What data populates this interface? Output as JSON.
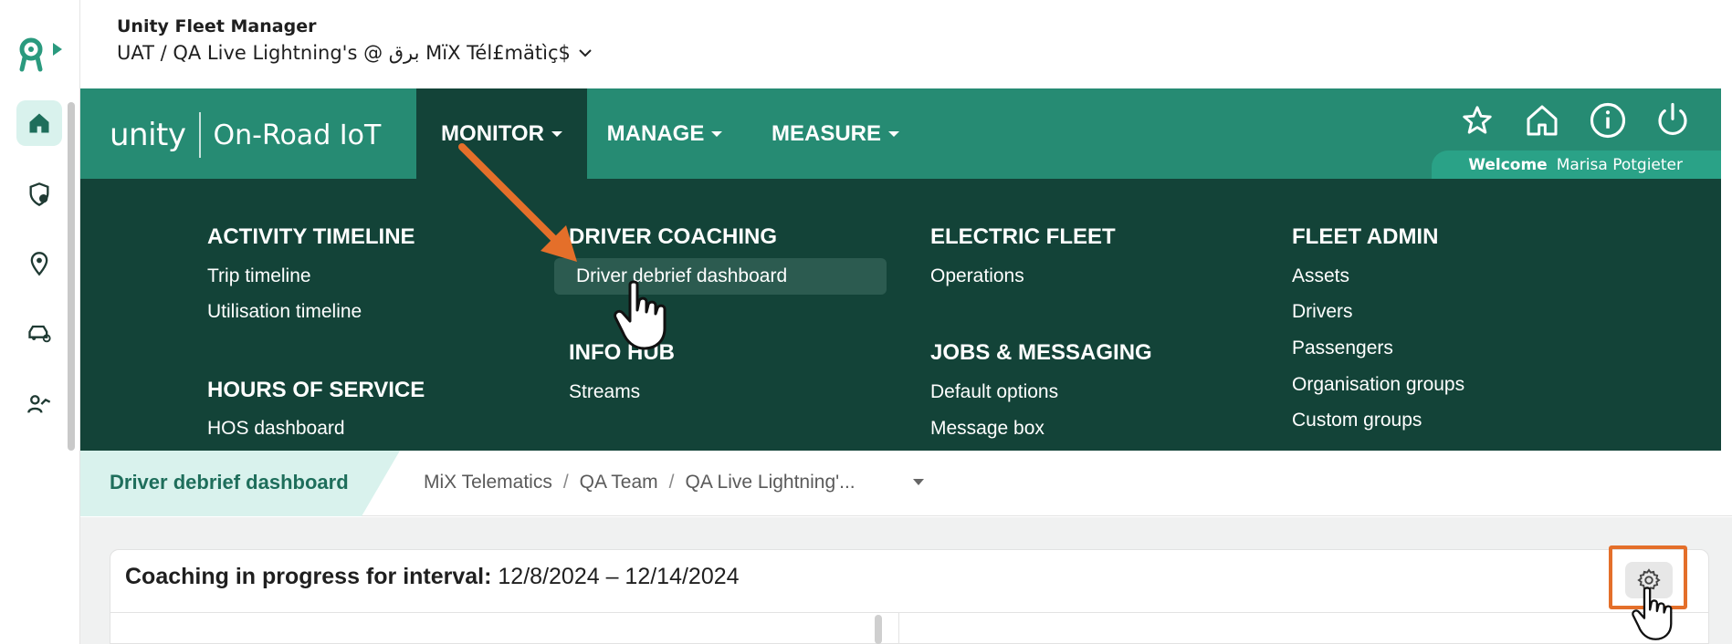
{
  "app": {
    "title": "Unity Fleet Manager",
    "org_path": "UAT / QA Live Lightning's @ برق MïX Tél£mätìç$"
  },
  "rail": {
    "items": [
      {
        "icon": "home-icon",
        "active": true
      },
      {
        "icon": "shield-user-icon",
        "active": false
      },
      {
        "icon": "location-pin-icon",
        "active": false
      },
      {
        "icon": "vehicle-settings-icon",
        "active": false
      },
      {
        "icon": "driver-trend-icon",
        "active": false
      }
    ]
  },
  "brand": {
    "unity": "unity",
    "product": "On-Road IoT"
  },
  "nav": {
    "tabs": [
      {
        "label": "MONITOR",
        "active": true
      },
      {
        "label": "MANAGE",
        "active": false
      },
      {
        "label": "MEASURE",
        "active": false
      }
    ],
    "welcome_label": "Welcome",
    "user_name": "Marisa Potgieter"
  },
  "menu": {
    "activity_timeline": {
      "heading": "ACTIVITY TIMELINE",
      "items": [
        "Trip timeline",
        "Utilisation timeline"
      ]
    },
    "hours_of_service": {
      "heading": "HOURS OF SERVICE",
      "items": [
        "HOS dashboard"
      ]
    },
    "driver_coaching": {
      "heading": "DRIVER COACHING",
      "items": [
        "Driver debrief dashboard"
      ]
    },
    "info_hub": {
      "heading": "INFO HUB",
      "items": [
        "Streams"
      ]
    },
    "electric_fleet": {
      "heading": "ELECTRIC FLEET",
      "items": [
        "Operations"
      ]
    },
    "jobs_messaging": {
      "heading": "JOBS & MESSAGING",
      "items": [
        "Default options",
        "Message box"
      ]
    },
    "fleet_admin": {
      "heading": "FLEET ADMIN",
      "items": [
        "Assets",
        "Drivers",
        "Passengers",
        "Organisation groups",
        "Custom groups"
      ]
    }
  },
  "breadcrumb": {
    "page": "Driver debrief dashboard",
    "trail": [
      "MiX Telematics",
      "QA Team",
      "QA Live Lightning'..."
    ]
  },
  "card": {
    "title_bold": "Coaching in progress for interval:",
    "interval": "12/8/2024 – 12/14/2024"
  },
  "colors": {
    "nav_green": "#268b73",
    "menu_dark": "#134338",
    "accent_teal": "#1e6e5b",
    "highlight_orange": "#e46f2a"
  }
}
